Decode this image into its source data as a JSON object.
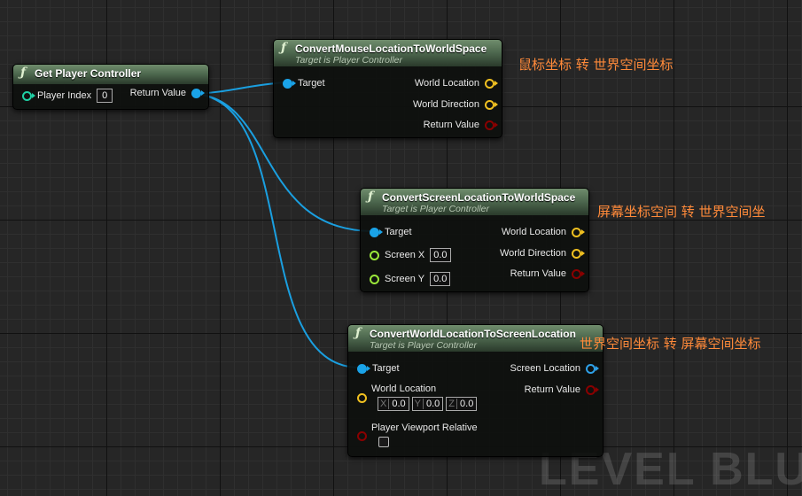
{
  "watermark": "LEVEL BLUEPRINT",
  "nodes": {
    "get_player_controller": {
      "title": "Get Player Controller",
      "pins": {
        "player_index_label": "Player Index",
        "player_index_value": "0",
        "return_value_label": "Return Value"
      }
    },
    "convert_mouse": {
      "title": "ConvertMouseLocationToWorldSpace",
      "subtitle": "Target is Player Controller",
      "pins": {
        "target": "Target",
        "world_location": "World Location",
        "world_direction": "World Direction",
        "return_value": "Return Value"
      }
    },
    "convert_screen": {
      "title": "ConvertScreenLocationToWorldSpace",
      "subtitle": "Target is Player Controller",
      "pins": {
        "target": "Target",
        "screen_x_label": "Screen X",
        "screen_x_value": "0.0",
        "screen_y_label": "Screen Y",
        "screen_y_value": "0.0",
        "world_location": "World Location",
        "world_direction": "World Direction",
        "return_value": "Return Value"
      }
    },
    "convert_world": {
      "title": "ConvertWorldLocationToScreenLocation",
      "subtitle": "Target is Player Controller",
      "pins": {
        "target": "Target",
        "world_location_label": "World Location",
        "x_axis": "X",
        "x_value": "0.0",
        "y_axis": "Y",
        "y_value": "0.0",
        "z_axis": "Z",
        "z_value": "0.0",
        "player_viewport_relative": "Player Viewport Relative",
        "screen_location": "Screen Location",
        "return_value": "Return Value"
      }
    }
  },
  "annotations": {
    "mouse": "鼠标坐标 转 世界空间坐标",
    "screen": "屏幕坐标空间 转 世界空间坐",
    "world": "世界空间坐标 转 屏幕空间坐标"
  },
  "colors": {
    "object_pin": "#1aa3e8",
    "vector_pin": "#f0c020",
    "bool_pin": "#8a0000",
    "int_pin": "#1fd0a4",
    "float_pin": "#9be83a",
    "vector2d_pin": "#2ea1e8",
    "wire": "#1a9fe0",
    "annotation": "#ff8a3a"
  }
}
